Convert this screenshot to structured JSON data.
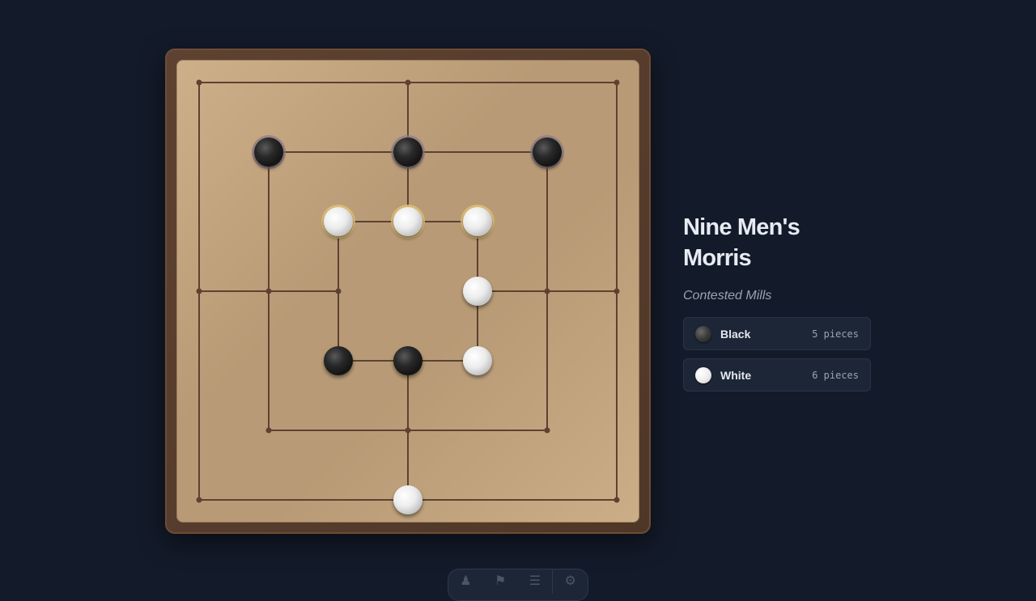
{
  "game": {
    "title": "Nine Men's Morris",
    "subtitle": "Contested Mills"
  },
  "players": [
    {
      "name": "Black",
      "count": "5 pieces",
      "color": "black"
    },
    {
      "name": "White",
      "count": "6 pieces",
      "color": "white"
    }
  ],
  "board": {
    "points": [
      {
        "id": "a7"
      },
      {
        "id": "d7"
      },
      {
        "id": "g7"
      },
      {
        "id": "b6"
      },
      {
        "id": "d6"
      },
      {
        "id": "f6"
      },
      {
        "id": "c5"
      },
      {
        "id": "d5"
      },
      {
        "id": "e5"
      },
      {
        "id": "a4"
      },
      {
        "id": "b4"
      },
      {
        "id": "c4"
      },
      {
        "id": "e4"
      },
      {
        "id": "f4"
      },
      {
        "id": "g4"
      },
      {
        "id": "c3"
      },
      {
        "id": "d3"
      },
      {
        "id": "e3"
      },
      {
        "id": "b2"
      },
      {
        "id": "d2"
      },
      {
        "id": "f2"
      },
      {
        "id": "a1"
      },
      {
        "id": "d1"
      },
      {
        "id": "g1"
      }
    ],
    "pieces": [
      {
        "point": "b6",
        "color": "black",
        "in_mill": true
      },
      {
        "point": "d6",
        "color": "black",
        "in_mill": true
      },
      {
        "point": "f6",
        "color": "black",
        "in_mill": true
      },
      {
        "point": "c5",
        "color": "white",
        "in_mill": true
      },
      {
        "point": "d5",
        "color": "white",
        "in_mill": true
      },
      {
        "point": "e5",
        "color": "white",
        "in_mill": true
      },
      {
        "point": "e4",
        "color": "white",
        "in_mill": false
      },
      {
        "point": "c3",
        "color": "black",
        "in_mill": false
      },
      {
        "point": "d3",
        "color": "black",
        "in_mill": false
      },
      {
        "point": "e3",
        "color": "white",
        "in_mill": false
      },
      {
        "point": "d1",
        "color": "white",
        "in_mill": false
      }
    ]
  },
  "toolbar": {
    "tools": [
      {
        "icon": "pawn-icon",
        "glyph": "♟"
      },
      {
        "icon": "flag-icon",
        "glyph": "⚑"
      },
      {
        "icon": "menu-icon",
        "glyph": "☰"
      },
      {
        "icon": "gear-icon",
        "glyph": "⚙"
      }
    ]
  },
  "colors": {
    "background": "#131a29",
    "board_surface": "#c1a47e",
    "board_frame": "#5e4231",
    "line": "#5e4131",
    "mill_glow_white": "#e3c27a",
    "mill_glow_black": "#8d7a88"
  }
}
